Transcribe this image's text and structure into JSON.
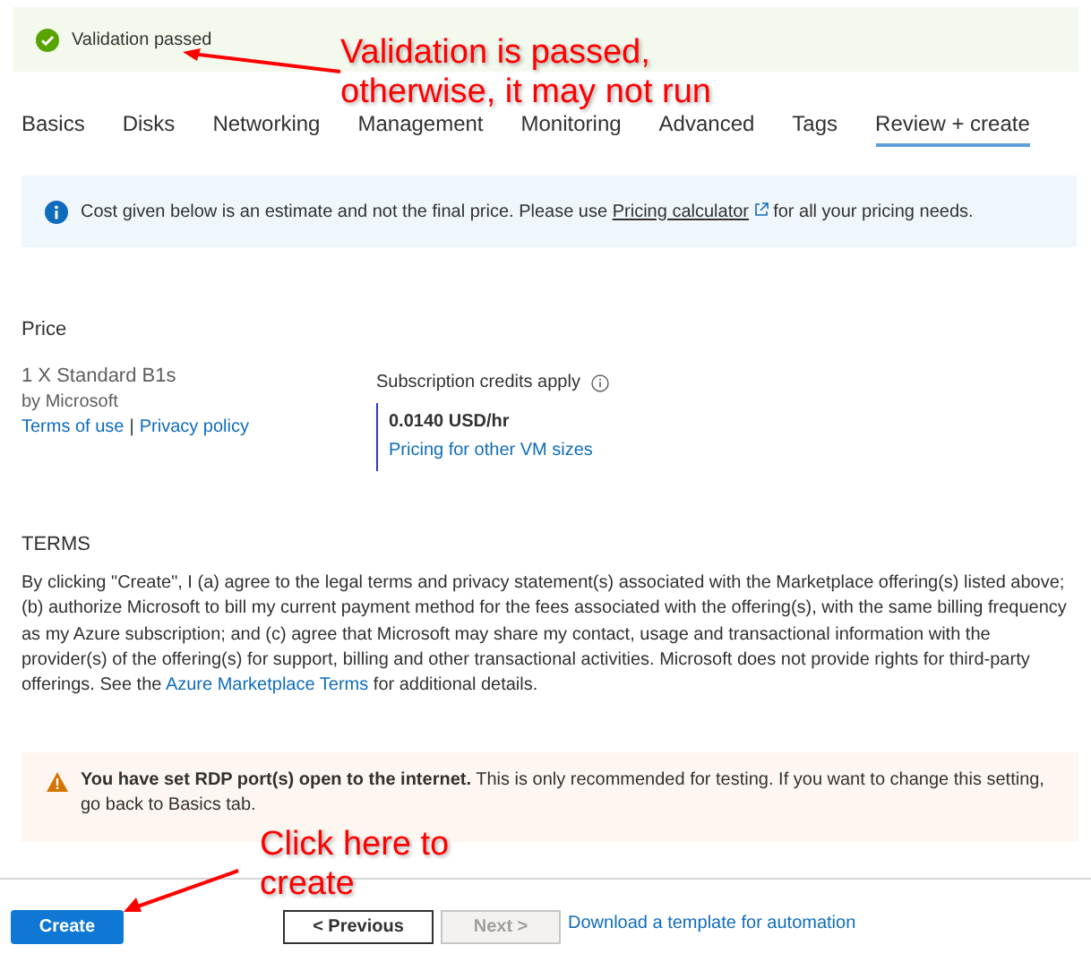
{
  "validation": {
    "message": "Validation passed",
    "passed": true
  },
  "tabs": [
    {
      "label": "Basics",
      "selected": false
    },
    {
      "label": "Disks",
      "selected": false
    },
    {
      "label": "Networking",
      "selected": false
    },
    {
      "label": "Management",
      "selected": false
    },
    {
      "label": "Monitoring",
      "selected": false
    },
    {
      "label": "Advanced",
      "selected": false
    },
    {
      "label": "Tags",
      "selected": false
    },
    {
      "label": "Review + create",
      "selected": true
    }
  ],
  "info": {
    "text": "Cost given below is an estimate and not the final price. Please use",
    "link": "Pricing calculator",
    "after": "for all your pricing needs."
  },
  "price": {
    "heading": "Price",
    "product": "1 X Standard B1s",
    "publisher": "by Microsoft",
    "terms_link": "Terms of use",
    "separator": "|",
    "privacy_link": "Privacy policy",
    "credits_label": "Subscription credits apply",
    "rate": "0.0140 USD/hr",
    "other_sizes_link": "Pricing for other VM sizes"
  },
  "terms": {
    "heading": "TERMS",
    "text": "By clicking \"Create\", I (a) agree to the legal terms and privacy statement(s) associated with the Marketplace offering(s) listed above; (b) authorize Microsoft to bill my current payment method for the fees associated with the offering(s), with the same billing frequency as my Azure subscription; and (c) agree that Microsoft may share my contact, usage and transactional information with the provider(s) of the offering(s) for support, billing and other transactional activities. Microsoft does not provide rights for third-party offerings. See the",
    "link": "Azure Marketplace Terms",
    "after": "for additional details."
  },
  "warning": {
    "text": "**You have set RDP port(s) open to the internet.**  This is only recommended for testing.  If you want to change this setting, go back to Basics tab."
  },
  "buttons": [
    {
      "label": "Create",
      "kind": "primary",
      "disabled": false
    },
    {
      "label": "< Previous",
      "kind": "secondary",
      "disabled": false
    },
    {
      "label": "Next >",
      "kind": "secondary",
      "disabled": true
    },
    {
      "label": "Download a template for automation",
      "kind": "link",
      "disabled": false
    }
  ],
  "annotations": [
    {
      "kind": "top",
      "text": "Validation is passed,\notherwise, it may not run"
    },
    {
      "kind": "bottom",
      "text": "Click here to\ncreate"
    }
  ]
}
